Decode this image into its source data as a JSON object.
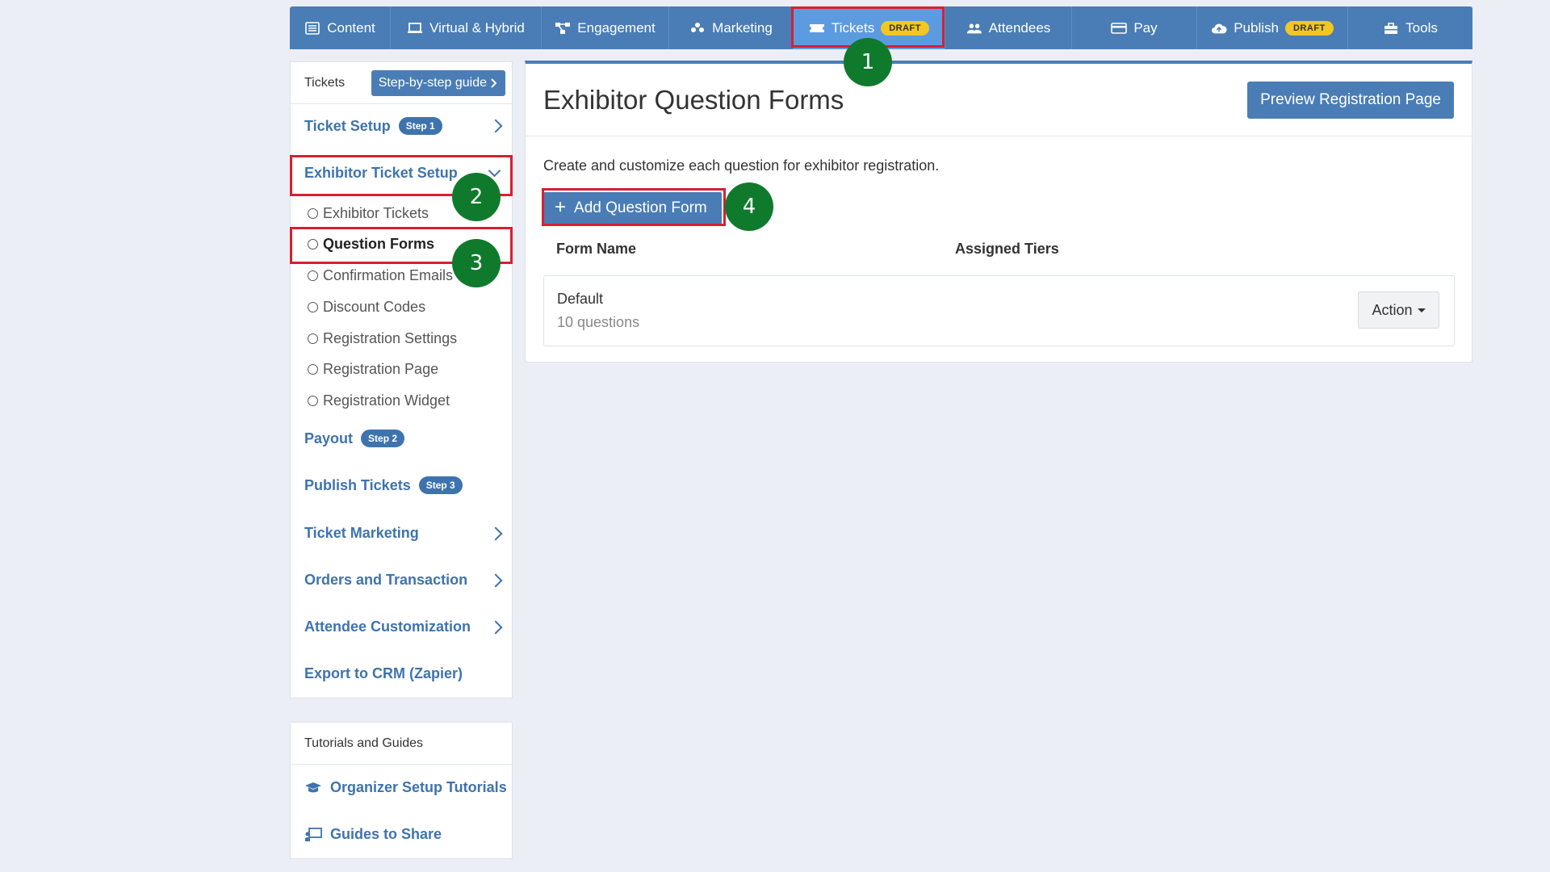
{
  "topnav": {
    "items": [
      {
        "label": "Content",
        "icon": "list-icon"
      },
      {
        "label": "Virtual & Hybrid",
        "icon": "laptop-icon"
      },
      {
        "label": "Engagement",
        "icon": "network-icon"
      },
      {
        "label": "Marketing",
        "icon": "people-group-icon"
      },
      {
        "label": "Tickets",
        "icon": "ticket-icon",
        "badge": "DRAFT"
      },
      {
        "label": "Attendees",
        "icon": "users-icon"
      },
      {
        "label": "Pay",
        "icon": "credit-card-icon"
      },
      {
        "label": "Publish",
        "icon": "cloud-upload-icon",
        "badge": "DRAFT"
      },
      {
        "label": "Tools",
        "icon": "toolbox-icon"
      }
    ]
  },
  "callouts": [
    "1",
    "2",
    "3",
    "4"
  ],
  "sidebar": {
    "title": "Tickets",
    "guide_button": "Step-by-step guide",
    "ticket_setup": {
      "label": "Ticket Setup",
      "step": "Step 1"
    },
    "exhibitor_setup": {
      "label": "Exhibitor Ticket Setup"
    },
    "sub_items": [
      "Exhibitor Tickets",
      "Question Forms",
      "Confirmation Emails",
      "Discount Codes",
      "Registration Settings",
      "Registration Page",
      "Registration Widget"
    ],
    "payout": {
      "label": "Payout",
      "step": "Step 2"
    },
    "publish": {
      "label": "Publish Tickets",
      "step": "Step 3"
    },
    "ticket_marketing": "Ticket Marketing",
    "orders": "Orders and Transaction",
    "attendee_custom": "Attendee Customization",
    "export": "Export to CRM (Zapier)"
  },
  "tutorials": {
    "title": "Tutorials and Guides",
    "items": [
      "Organizer Setup Tutorials",
      "Guides to Share"
    ]
  },
  "main": {
    "title": "Exhibitor Question Forms",
    "preview_button": "Preview Registration Page",
    "description": "Create and customize each question for exhibitor registration.",
    "add_button": "Add Question Form",
    "columns": [
      "Form Name",
      "Assigned Tiers"
    ],
    "rows": [
      {
        "name": "Default",
        "count": "10 questions",
        "action": "Action"
      }
    ]
  },
  "colors": {
    "primary": "#4a7db5",
    "highlight": "#d62031",
    "callout": "#0f7a2c",
    "draft": "#f2c624"
  }
}
